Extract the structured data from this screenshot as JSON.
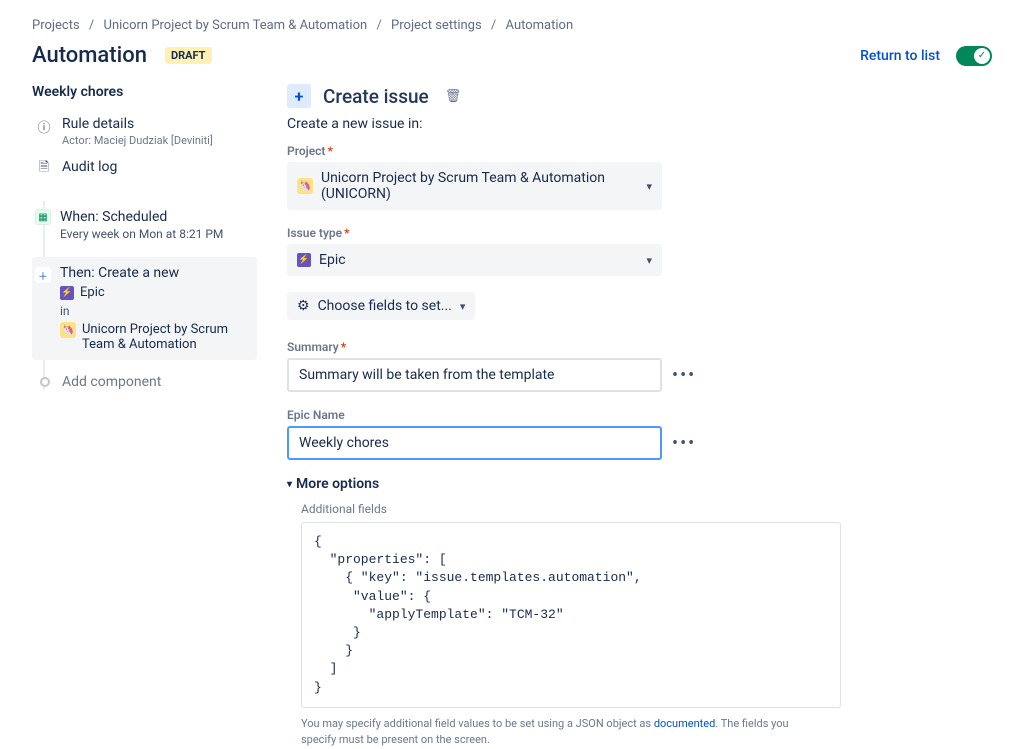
{
  "breadcrumb": {
    "projects": "Projects",
    "project": "Unicorn Project by Scrum Team & Automation",
    "settings": "Project settings",
    "automation": "Automation"
  },
  "header": {
    "title": "Automation",
    "badge": "DRAFT",
    "return": "Return to list"
  },
  "sidebar": {
    "heading": "Weekly chores",
    "rule_details": "Rule details",
    "actor_line": "Actor: Maciej Dudziak [Deviniti]",
    "audit_log": "Audit log",
    "when_title": "When: Scheduled",
    "when_sub": "Every week on Mon at 8:21 PM",
    "then_title": "Then: Create a new",
    "epic_label": "Epic",
    "in_label": "in",
    "then_project": "Unicorn Project by Scrum Team & Automation",
    "add_component": "Add component"
  },
  "main": {
    "panel_title": "Create issue",
    "subhead": "Create a new issue in:",
    "project_label": "Project",
    "project_value": "Unicorn Project by Scrum Team & Automation (UNICORN)",
    "issuetype_label": "Issue type",
    "issuetype_value": "Epic",
    "choose_fields": "Choose fields to set...",
    "summary_label": "Summary",
    "summary_value": "Summary will be taken from the template",
    "epicname_label": "Epic Name",
    "epicname_value": "Weekly chores",
    "more_options": "More options",
    "additional_fields": "Additional fields",
    "json": "{\n  \"properties\": [\n    { \"key\": \"issue.templates.automation\",\n     \"value\": {\n       \"applyTemplate\": \"TCM-32\"\n     }\n    }\n  ]\n}",
    "hint_pre": "You may specify additional field values to be set using a JSON object as ",
    "hint_link": "documented",
    "hint_post": ". The fields you specify must be present on the screen."
  }
}
